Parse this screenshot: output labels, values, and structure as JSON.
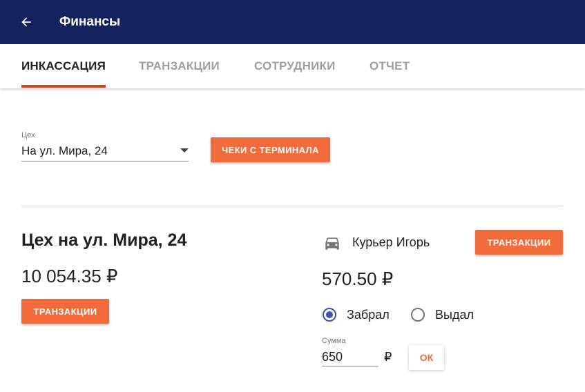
{
  "appbar": {
    "title": "Финансы",
    "back_icon": "arrow-left-icon"
  },
  "tabs": [
    {
      "label": "ИНКАССАЦИЯ",
      "active": true
    },
    {
      "label": "ТРАНЗАКЦИИ",
      "active": false
    },
    {
      "label": "СОТРУДНИКИ",
      "active": false
    },
    {
      "label": "ОТЧЕТ",
      "active": false
    }
  ],
  "filter": {
    "shop_label": "Цех",
    "shop_value": "На ул. Мира, 24",
    "receipts_button": "ЧЕКИ С ТЕРМИНАЛА"
  },
  "shop": {
    "title": "Цех на ул. Мира, 24",
    "balance": "10 054.35 ₽",
    "transactions_button": "ТРАНЗАКЦИИ"
  },
  "courier": {
    "icon": "car-icon",
    "name": "Курьер Игорь",
    "transactions_button": "ТРАНЗАКЦИИ",
    "balance": "570.50 ₽",
    "options": [
      {
        "label": "Забрал",
        "checked": true
      },
      {
        "label": "Выдал",
        "checked": false
      }
    ],
    "amount_label": "Сумма",
    "amount_value": "650",
    "currency": "₽",
    "ok_button": "ОК"
  },
  "colors": {
    "appbar": "#14225e",
    "accent": "#f26b3a",
    "tab_indicator": "#d84315",
    "radio_checked": "#3f51b5"
  }
}
